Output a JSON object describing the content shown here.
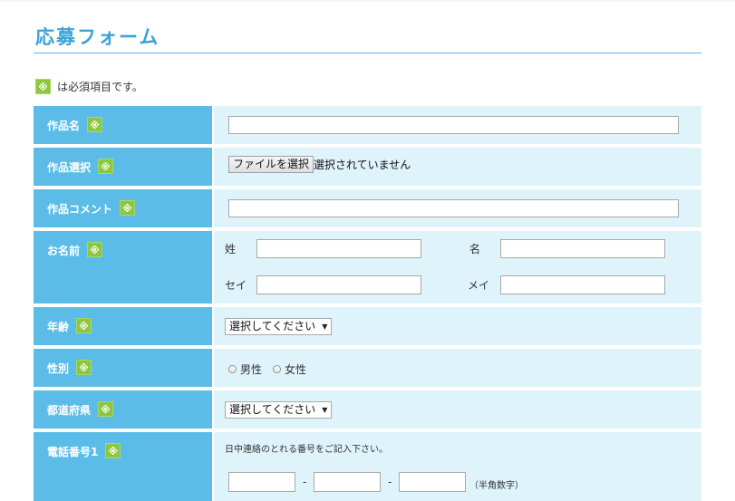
{
  "form_title": "応募フォーム",
  "required_note": {
    "badge": "※",
    "text": "は必須項目です。"
  },
  "rows": {
    "title": {
      "label": "作品名",
      "badge": "※",
      "value": ""
    },
    "file": {
      "label": "作品選択",
      "badge": "※",
      "button": "ファイルを選択",
      "status": "選択されていません"
    },
    "comment": {
      "label": "作品コメント",
      "badge": "※",
      "value": ""
    },
    "name": {
      "label": "お名前",
      "badge": "※",
      "sei_label": "姓",
      "mei_label": "名",
      "sei_kana_label": "セイ",
      "mei_kana_label": "メイ",
      "sei_value": "",
      "mei_value": "",
      "sei_kana_value": "",
      "mei_kana_value": ""
    },
    "age": {
      "label": "年齢",
      "badge": "※",
      "select": "選択してください"
    },
    "gender": {
      "label": "性別",
      "badge": "※",
      "options": [
        "男性",
        "女性"
      ]
    },
    "prefecture": {
      "label": "都道府県",
      "badge": "※",
      "select": "選択してください"
    },
    "phone": {
      "label": "電話番号1",
      "badge": "※",
      "note": "日中連絡のとれる番号をご記入下さい。",
      "separator": "-",
      "hint": "（半角数字）",
      "part1": "",
      "part2": "",
      "part3": ""
    }
  },
  "colors": {
    "title": "#39a4d6",
    "label_bg": "#5bbde7",
    "cell_bg": "#dff3fb",
    "badge": "#8dc63f"
  },
  "icons": {
    "select_arrow": "▼"
  }
}
